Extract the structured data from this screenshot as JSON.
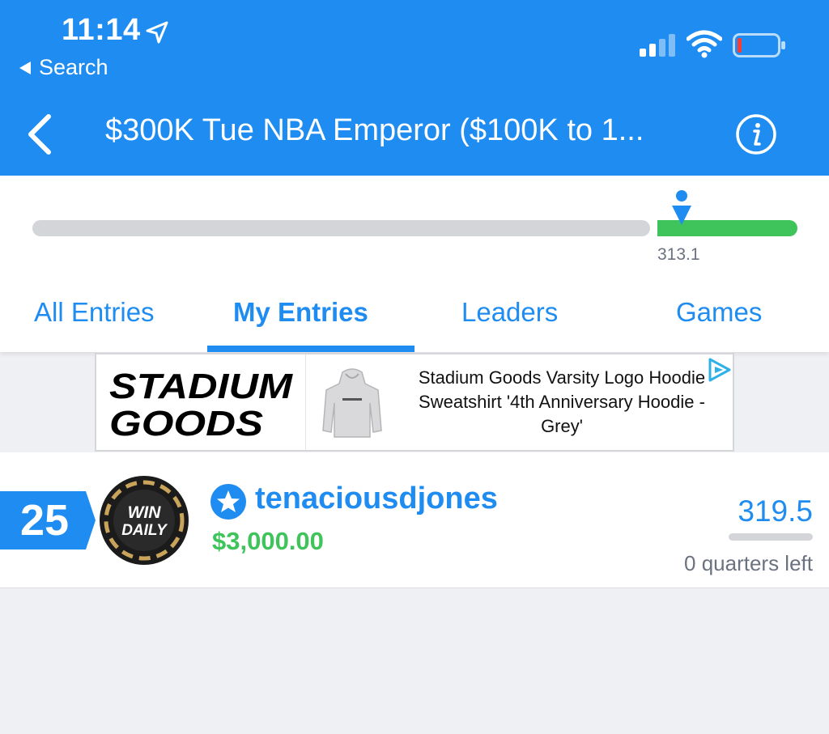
{
  "status_bar": {
    "time": "11:14",
    "back_app_label": "Search",
    "icons": [
      "location-arrow-icon",
      "cellular-signal-icon",
      "wifi-icon",
      "battery-low-icon"
    ]
  },
  "nav": {
    "title": "$300K Tue NBA Emperor ($100K to 1...",
    "back_icon": "chevron-left-icon",
    "info_icon": "info-icon"
  },
  "progress": {
    "score_label": "313.1",
    "marker_fraction": 0.81
  },
  "tabs": [
    {
      "label": "All Entries",
      "active": false
    },
    {
      "label": "My Entries",
      "active": true
    },
    {
      "label": "Leaders",
      "active": false
    },
    {
      "label": "Games",
      "active": false
    }
  ],
  "ad": {
    "logo_text_line1": "STADIUM",
    "logo_text_line2": "GOODS",
    "product_text": "Stadium Goods Varsity Logo Hoodie Sweatshirt '4th Anniversary Hoodie - Grey'",
    "adchoices_icon": "adchoices-icon"
  },
  "entry": {
    "rank": "25",
    "avatar_text_line1": "WIN",
    "avatar_text_line2": "DAILY",
    "username": "tenaciousdjones",
    "winnings": "$3,000.00",
    "points": "319.5",
    "remaining": "0 quarters left"
  },
  "colors": {
    "brand_blue": "#1e8cf0",
    "green": "#3ec45a",
    "grey_track": "#d3d5d9",
    "background": "#eff0f4"
  }
}
